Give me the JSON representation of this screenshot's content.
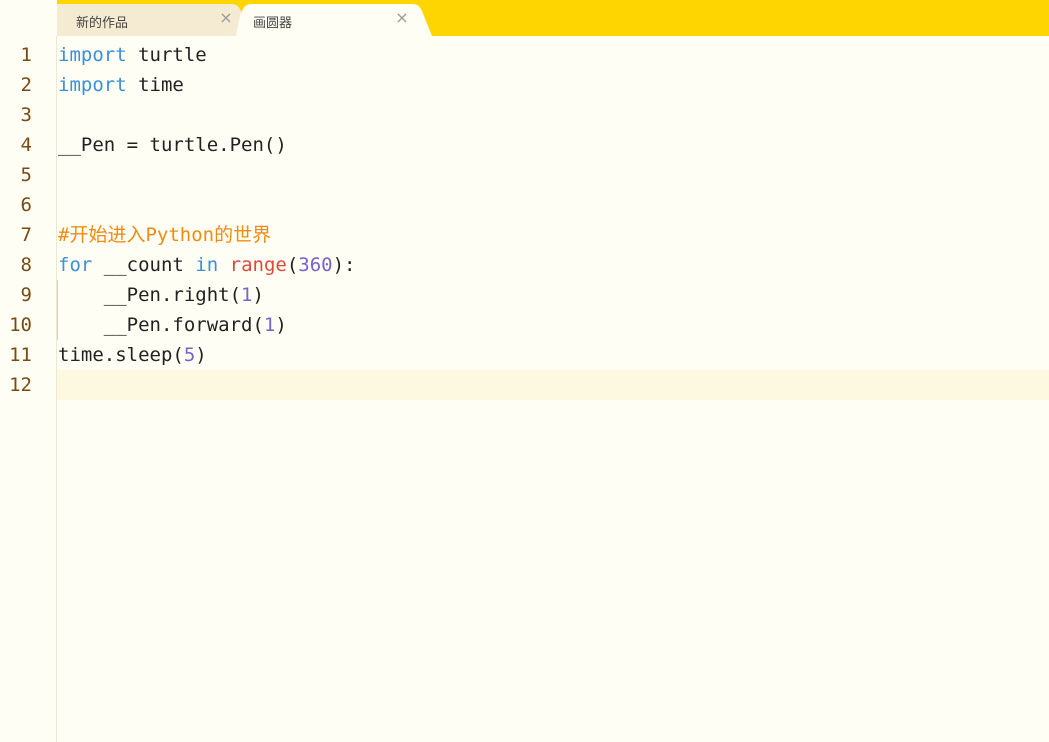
{
  "tabs": [
    {
      "label": "新的作品",
      "active": false,
      "close_glyph": "×"
    },
    {
      "label": "画圆器",
      "active": true,
      "close_glyph": "×"
    }
  ],
  "colors": {
    "tabbar_yellow": "#ffd500",
    "editor_bg": "#fffef4",
    "current_line_bg": "#fdf8e0",
    "keyword": "#3d8fd6",
    "builtin": "#e2473d",
    "number": "#7b61c9",
    "comment": "#f08b12",
    "line_number": "#7a4a14"
  },
  "editor": {
    "current_line": 12,
    "lines": [
      {
        "number": "1",
        "tokens": [
          {
            "t": "import",
            "c": "kw"
          },
          {
            "t": " turtle",
            "c": "pl"
          }
        ]
      },
      {
        "number": "2",
        "tokens": [
          {
            "t": "import",
            "c": "kw"
          },
          {
            "t": " time",
            "c": "pl"
          }
        ]
      },
      {
        "number": "3",
        "tokens": []
      },
      {
        "number": "4",
        "tokens": [
          {
            "t": "__Pen = turtle.Pen()",
            "c": "pl"
          }
        ]
      },
      {
        "number": "5",
        "tokens": []
      },
      {
        "number": "6",
        "tokens": []
      },
      {
        "number": "7",
        "tokens": [
          {
            "t": "#开始进入Python的世界",
            "c": "cm"
          }
        ]
      },
      {
        "number": "8",
        "tokens": [
          {
            "t": "for",
            "c": "kw"
          },
          {
            "t": " __count ",
            "c": "pl"
          },
          {
            "t": "in",
            "c": "kw"
          },
          {
            "t": " ",
            "c": "pl"
          },
          {
            "t": "range",
            "c": "fn"
          },
          {
            "t": "(",
            "c": "pl"
          },
          {
            "t": "360",
            "c": "num"
          },
          {
            "t": "):",
            "c": "pl"
          }
        ]
      },
      {
        "number": "9",
        "tokens": [
          {
            "t": "    __Pen.right(",
            "c": "pl"
          },
          {
            "t": "1",
            "c": "num"
          },
          {
            "t": ")",
            "c": "pl"
          }
        ]
      },
      {
        "number": "10",
        "tokens": [
          {
            "t": "    __Pen.forward(",
            "c": "pl"
          },
          {
            "t": "1",
            "c": "num"
          },
          {
            "t": ")",
            "c": "pl"
          }
        ]
      },
      {
        "number": "11",
        "tokens": [
          {
            "t": "time.sleep(",
            "c": "pl"
          },
          {
            "t": "5",
            "c": "num"
          },
          {
            "t": ")",
            "c": "pl"
          }
        ]
      },
      {
        "number": "12",
        "tokens": []
      }
    ]
  }
}
